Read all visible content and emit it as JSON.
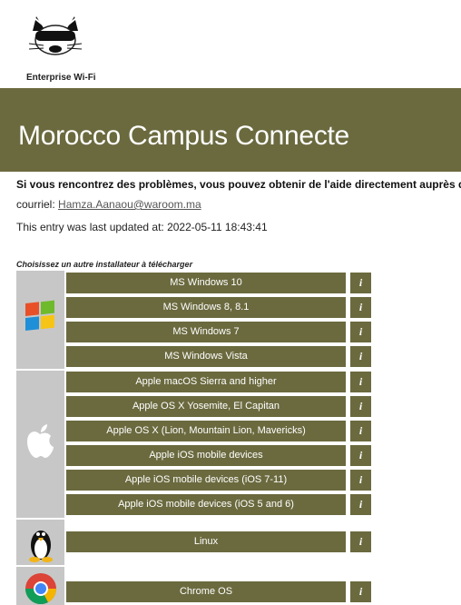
{
  "header": {
    "logo_caption": "Enterprise Wi-Fi",
    "banner_title": "Morocco Campus Connecte"
  },
  "help": {
    "text": "Si vous rencontrez des problèmes, vous pouvez obtenir de l'aide directement auprès de",
    "contact_label": "courriel:",
    "contact_email": "Hamza.Aanaou@waroom.ma",
    "updated": "This entry was last updated at: 2022-05-11 18:43:41"
  },
  "installers": {
    "heading": "Choisissez un autre installateur à télécharger",
    "info_label": "i",
    "windows": [
      "MS Windows 10",
      "MS Windows 8, 8.1",
      "MS Windows 7",
      "MS Windows Vista"
    ],
    "apple": [
      "Apple macOS Sierra and higher",
      "Apple OS X Yosemite, El Capitan",
      "Apple OS X (Lion, Mountain Lion, Mavericks)",
      "Apple iOS mobile devices",
      "Apple iOS mobile devices (iOS 7-11)",
      "Apple iOS mobile devices (iOS 5 and 6)"
    ],
    "linux": [
      "Linux"
    ],
    "chrome": [
      "Chrome OS"
    ]
  },
  "icons": {
    "logo": "cat-goggles-logo-icon",
    "windows": "windows-logo-icon",
    "apple": "apple-logo-icon",
    "linux": "tux-penguin-icon",
    "chrome": "chrome-logo-icon"
  },
  "colors": {
    "banner": "#6b6a3f",
    "button": "#6b6a3f",
    "icon_panel": "#c7c7c7"
  }
}
